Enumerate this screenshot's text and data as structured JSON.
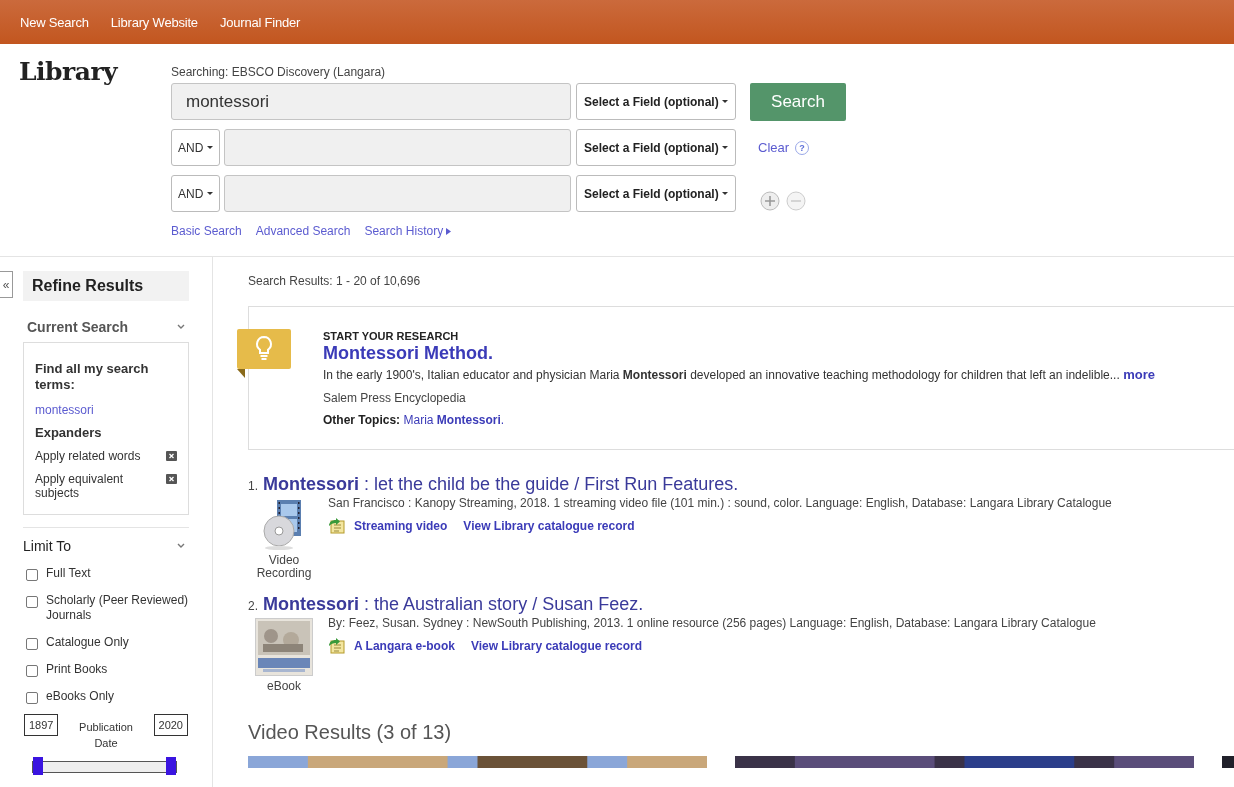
{
  "nav": [
    "New Search",
    "Library Website",
    "Journal Finder"
  ],
  "logo": "Library",
  "search": {
    "searching": "Searching: EBSCO Discovery (Langara)",
    "rows": [
      {
        "value": "montessori",
        "field": "Select a Field (optional)"
      },
      {
        "operator": "AND",
        "field": "Select a Field (optional)"
      },
      {
        "operator": "AND",
        "field": "Select a Field (optional)"
      }
    ],
    "button": "Search",
    "clear": "Clear",
    "help": "?",
    "links": [
      "Basic Search",
      "Advanced Search",
      "Search History"
    ]
  },
  "sidebar": {
    "collapse": "«",
    "title": "Refine Results",
    "current_search": {
      "title": "Current Search",
      "find_label": "Find all my search terms:",
      "term": "montessori",
      "expanders_title": "Expanders",
      "expanders": [
        "Apply related words",
        "Apply equivalent subjects"
      ]
    },
    "limit_to": {
      "title": "Limit To",
      "options": [
        {
          "label": "Full Text",
          "checked": false
        },
        {
          "label": "Scholarly (Peer Reviewed) Journals",
          "checked": false
        },
        {
          "label": "Catalogue Only",
          "checked": false
        },
        {
          "label": "Print Books",
          "checked": false
        },
        {
          "label": "eBooks Only",
          "checked": false
        }
      ]
    },
    "date": {
      "from": "1897",
      "label": "Publication Date",
      "to": "2020",
      "thumbs": [
        {
          "level": 0
        },
        {
          "level": 1
        }
      ]
    }
  },
  "results_count": "Search Results: 1 - 20 of 10,696",
  "research": {
    "kicker": "START YOUR RESEARCH",
    "title": "Montessori Method.",
    "snippet": "In the early 1900's, Italian educator and physician Maria **Montessori** developed an innovative teaching methodology for children that left an indelible...",
    "more": "more",
    "source": "Salem Press Encyclopedia",
    "topics_label": "Other Topics:",
    "topic": "Maria **Montessori**."
  },
  "results": [
    {
      "number": "1.",
      "title": "**Montessori** : let the child be the guide / First Run Features.",
      "meta": "San Francisco : Kanopy Streaming, 2018. 1 streaming video file (101 min.) : sound, color. Language: English, Database: Langara Library Catalogue",
      "kind": "video",
      "type_label": "Video Recording",
      "links": [
        "Streaming video",
        "View Library catalogue record"
      ]
    },
    {
      "number": "2.",
      "title": "**Montessori** : the Australian story / Susan Feez.",
      "meta": "By: Feez, Susan. Sydney : NewSouth Publishing, 2013. 1 online resource (256 pages) Language: English, Database: Langara Library Catalogue",
      "kind": "ebook",
      "type_label": "eBook",
      "links": [
        "A Langara e-book",
        "View Library catalogue record"
      ]
    }
  ],
  "video_results": {
    "title": "Video Results (3 of 13)"
  }
}
